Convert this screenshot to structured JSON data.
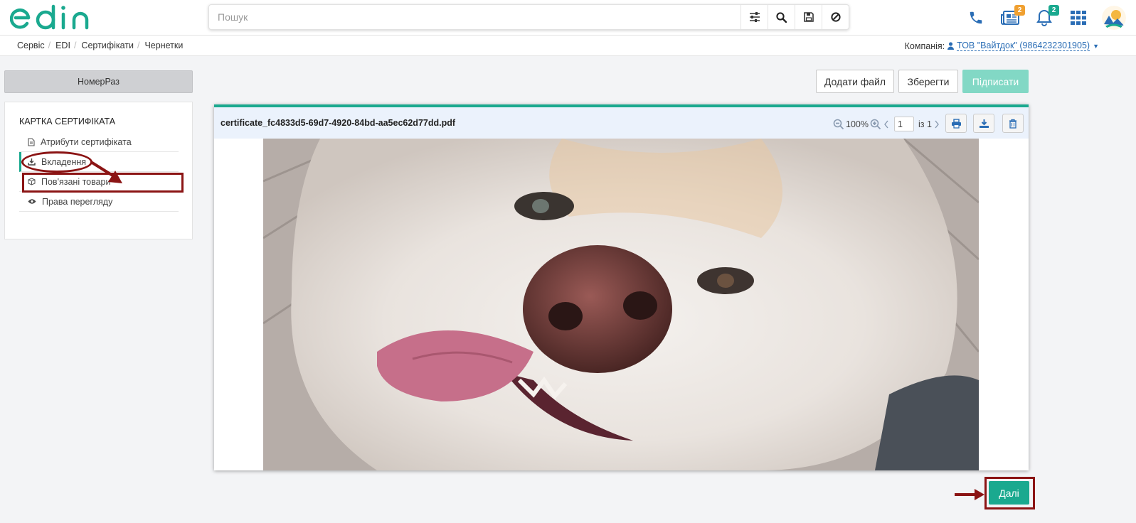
{
  "app": {
    "logo_text": "edin",
    "brand_color": "#1aa98f"
  },
  "search": {
    "placeholder": "Пошук"
  },
  "header": {
    "icons": [
      "phone-icon",
      "newspaper-icon",
      "bell-icon",
      "apps-grid-icon"
    ],
    "news_badge": "2",
    "notifications_badge": "2"
  },
  "breadcrumb": {
    "items": [
      "Сервіс",
      "EDI",
      "Сертифікати",
      "Чернетки"
    ]
  },
  "company": {
    "label": "Компанія:",
    "name": "ТОВ \"Вайтдок\" (9864232301905)"
  },
  "sidebar": {
    "number_button": "НомерРаз",
    "card_title": "КАРТКА СЕРТИФІКАТА",
    "items": [
      {
        "label": "Атрибути сертифіката",
        "icon": "document-icon"
      },
      {
        "label": "Вкладення",
        "icon": "download-icon"
      },
      {
        "label": "Пов'язані товари",
        "icon": "box-icon"
      },
      {
        "label": "Права перегляду",
        "icon": "eye-icon"
      }
    ]
  },
  "actions": {
    "add_file": "Додати файл",
    "save": "Зберегти",
    "sign": "Підписати"
  },
  "viewer": {
    "filename": "certificate_fc4833d5-69d7-4920-84bd-aa5ec62d77dd.pdf",
    "zoom": "100%",
    "page": "1",
    "of_pages": "із 1"
  },
  "footer": {
    "next": "Далі"
  },
  "colors": {
    "annotation": "#8b1414",
    "sign_button": "#82d8c5",
    "viewer_header": "#ebf2fc"
  }
}
